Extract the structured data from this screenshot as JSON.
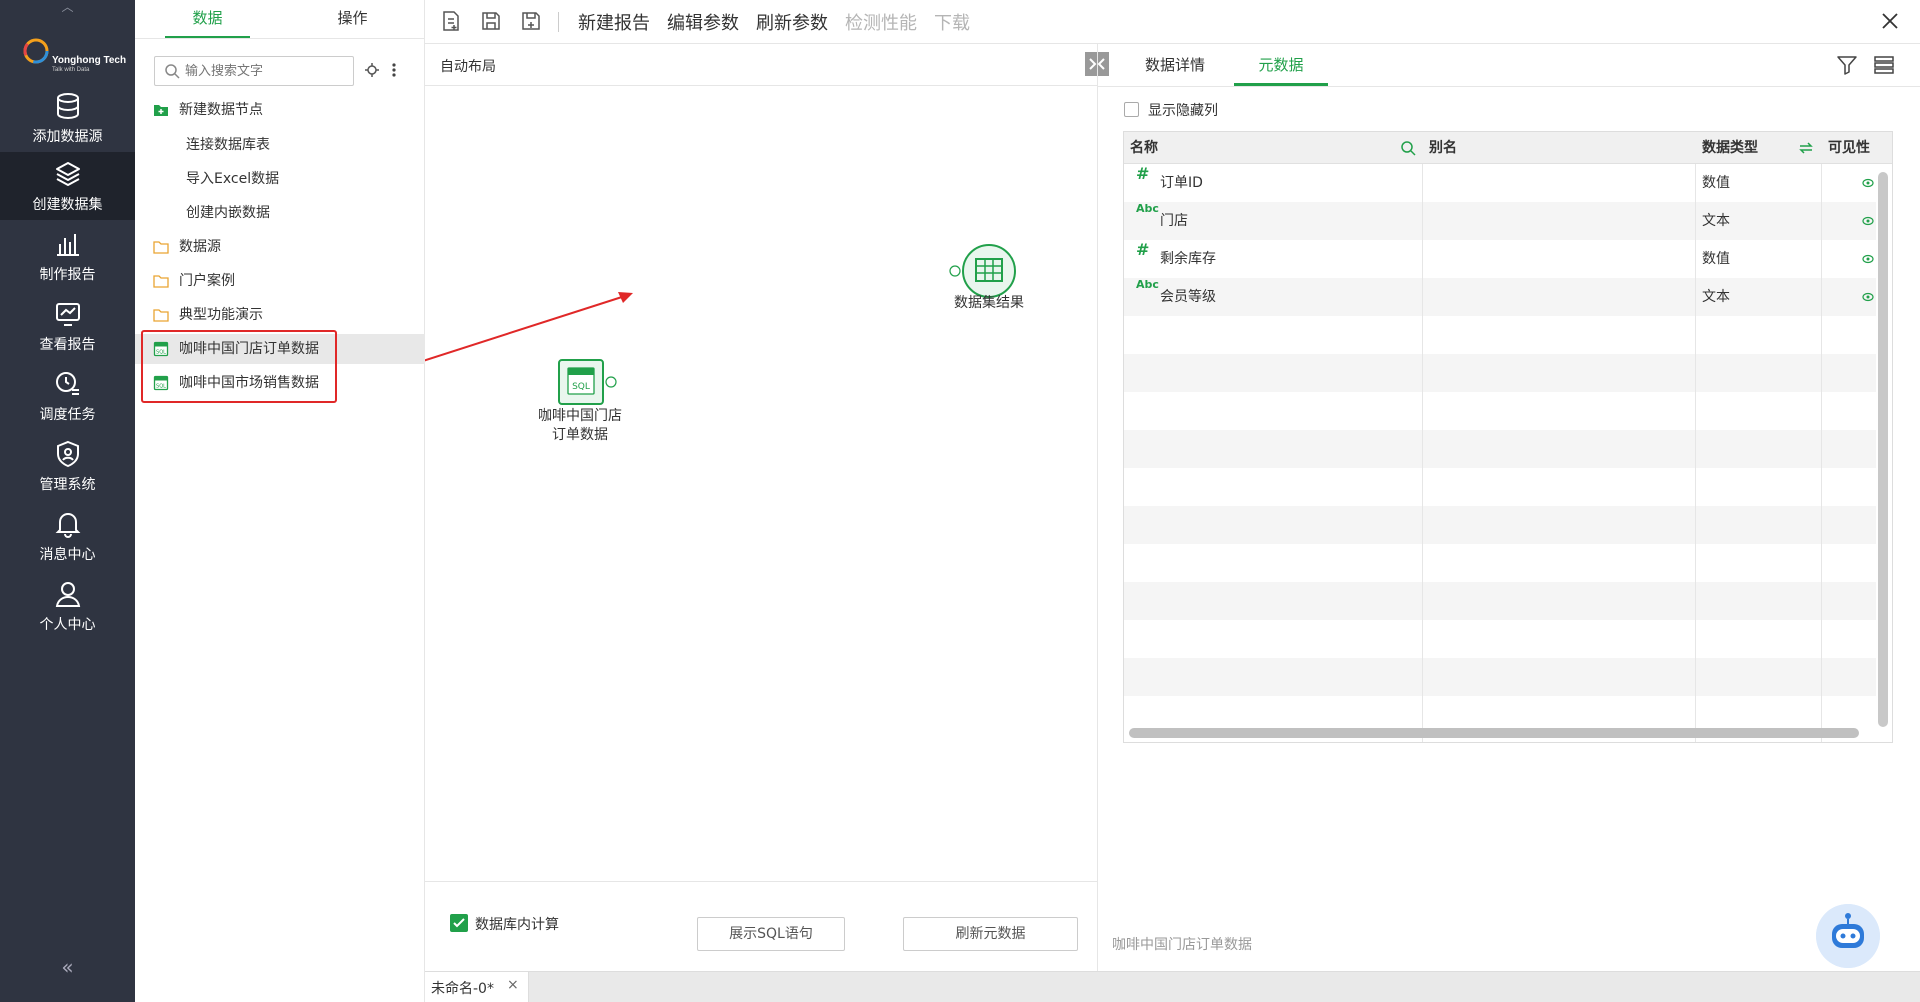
{
  "nav": {
    "logo_text": "Yonghong Tech",
    "logo_sub": "Talk with Data",
    "items": [
      {
        "label": "添加数据源",
        "icon": "database-icon"
      },
      {
        "label": "创建数据集",
        "icon": "layers-icon"
      },
      {
        "label": "制作报告",
        "icon": "bar-chart-icon"
      },
      {
        "label": "查看报告",
        "icon": "monitor-chart-icon"
      },
      {
        "label": "调度任务",
        "icon": "clock-list-icon"
      },
      {
        "label": "管理系统",
        "icon": "shield-user-icon"
      },
      {
        "label": "消息中心",
        "icon": "bell-icon"
      },
      {
        "label": "个人中心",
        "icon": "user-icon"
      }
    ],
    "active_index": 1
  },
  "data_panel": {
    "tabs": [
      "数据",
      "操作"
    ],
    "active_tab": 0,
    "search_placeholder": "输入搜索文字",
    "tree": [
      {
        "label": "新建数据节点",
        "icon": "folder-add-icon",
        "indent": 0
      },
      {
        "label": "连接数据库表",
        "icon": "",
        "indent": 1
      },
      {
        "label": "导入Excel数据",
        "icon": "",
        "indent": 1
      },
      {
        "label": "创建内嵌数据",
        "icon": "",
        "indent": 1
      },
      {
        "label": "数据源",
        "icon": "folder-icon",
        "indent": 0
      },
      {
        "label": "门户案例",
        "icon": "folder-icon",
        "indent": 0
      },
      {
        "label": "典型功能演示",
        "icon": "folder-icon",
        "indent": 0
      },
      {
        "label": "咖啡中国门店订单数据",
        "icon": "sql-file-icon",
        "indent": 0,
        "selected": true
      },
      {
        "label": "咖啡中国市场销售数据",
        "icon": "sql-file-icon",
        "indent": 0
      }
    ]
  },
  "toolbar": {
    "buttons": [
      {
        "label": "新建报告",
        "disabled": false
      },
      {
        "label": "编辑参数",
        "disabled": false
      },
      {
        "label": "刷新参数",
        "disabled": false
      },
      {
        "label": "检测性能",
        "disabled": true
      },
      {
        "label": "下载",
        "disabled": true
      }
    ]
  },
  "canvas": {
    "layout_label": "自动布局",
    "nodes": [
      {
        "label_line1": "咖啡中国门店",
        "label_line2": "订单数据",
        "type": "sql"
      },
      {
        "label_line1": "数据集结果",
        "label_line2": "",
        "type": "result"
      }
    ],
    "db_calc_label": "数据库内计算",
    "db_calc_checked": true,
    "show_sql_label": "展示SQL语句",
    "refresh_meta_label": "刷新元数据"
  },
  "doc_tab": {
    "label": "未命名-0*",
    "close": "×"
  },
  "right_panel": {
    "tabs": [
      "数据详情",
      "元数据"
    ],
    "active_tab": 1,
    "show_hidden_label": "显示隐藏列",
    "columns": [
      "名称",
      "别名",
      "数据类型",
      "可见性"
    ],
    "rows": [
      {
        "name": "订单ID",
        "alias": "",
        "type": "数值",
        "type_icon": "#"
      },
      {
        "name": "门店",
        "alias": "",
        "type": "文本",
        "type_icon": "Abc"
      },
      {
        "name": "剩余库存",
        "alias": "",
        "type": "数值",
        "type_icon": "#"
      },
      {
        "name": "会员等级",
        "alias": "",
        "type": "文本",
        "type_icon": "Abc"
      }
    ],
    "footer_label": "咖啡中国门店订单数据"
  },
  "colors": {
    "accent": "#21a04a",
    "nav_bg": "#2f3441",
    "annotation": "#e02828"
  }
}
